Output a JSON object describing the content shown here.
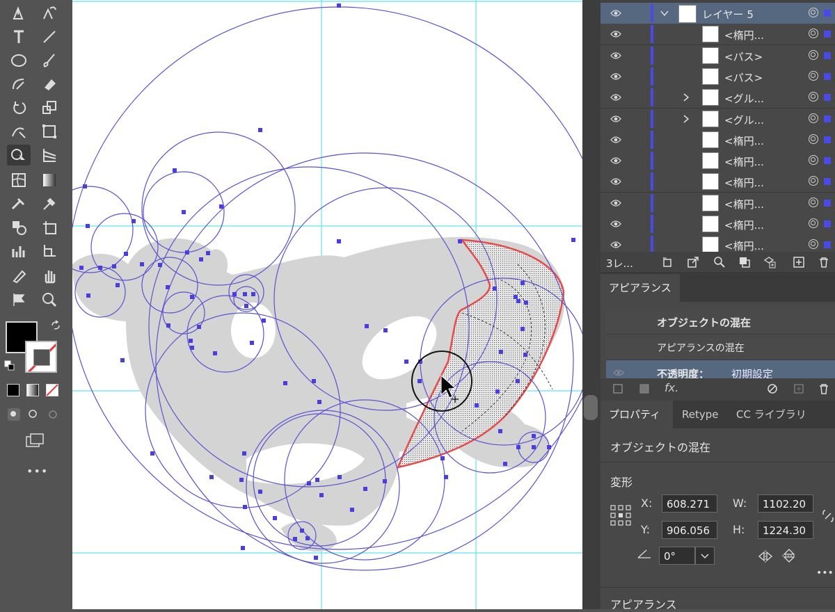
{
  "toolbar": {
    "tools": [
      "pen-icon",
      "curvature-icon",
      "type-icon",
      "line-icon",
      "ellipse-icon",
      "paintbrush-icon",
      "shaper-icon",
      "eraser-icon",
      "rotate-icon",
      "scale-icon",
      "warp-icon",
      "free-transform-icon",
      "shape-builder-icon",
      "perspective-grid-icon",
      "mesh-icon",
      "gradient-icon",
      "eyedropper-icon",
      "measure-icon",
      "symbol-sprayer-icon",
      "artboard-icon",
      "column-graph-icon",
      "slice-icon",
      "pencil-icon",
      "hand-icon",
      "flag-icon",
      "zoom-icon"
    ],
    "fill_color": "#000000",
    "stroke_color": "none",
    "more": "•••"
  },
  "layers": {
    "rows": [
      {
        "name": "レイヤー 5",
        "active": true,
        "expanded": true
      },
      {
        "name": "<楕円..."
      },
      {
        "name": "<パス>"
      },
      {
        "name": "<パス>"
      },
      {
        "name": "<グル...",
        "group": true
      },
      {
        "name": "<グル...",
        "group": true
      },
      {
        "name": "<楕円..."
      },
      {
        "name": "<楕円..."
      },
      {
        "name": "<楕円..."
      },
      {
        "name": "<楕円..."
      },
      {
        "name": "<楕円..."
      },
      {
        "name": "<楕円..."
      }
    ],
    "footer_count": "3レ..."
  },
  "appearance": {
    "tab": "アピアランス",
    "title": "オブジェクトの混在",
    "subtitle": "アピアランスの混在",
    "opacity_label": "不透明度：",
    "opacity_value": "初期設定",
    "fx": "fx."
  },
  "properties": {
    "tabs": [
      "プロパティ",
      "Retype",
      "CC ライブラリ"
    ],
    "object_type": "オブジェクトの混在",
    "transform_label": "変形",
    "x_label": "X:",
    "x_value": "608.271",
    "y_label": "Y:",
    "y_value": "906.056",
    "w_label": "W:",
    "w_value": "1102.20",
    "h_label": "H:",
    "h_value": "1224.30",
    "angle_value": "0°",
    "appearance_label": "アピアランス",
    "more": "•••"
  },
  "colors": {
    "guide": "#5be7f2",
    "path": "#5a52cf",
    "anchor": "#4a3ee0",
    "highlight": "#e64a4a",
    "fill": "#d4d4d4"
  }
}
